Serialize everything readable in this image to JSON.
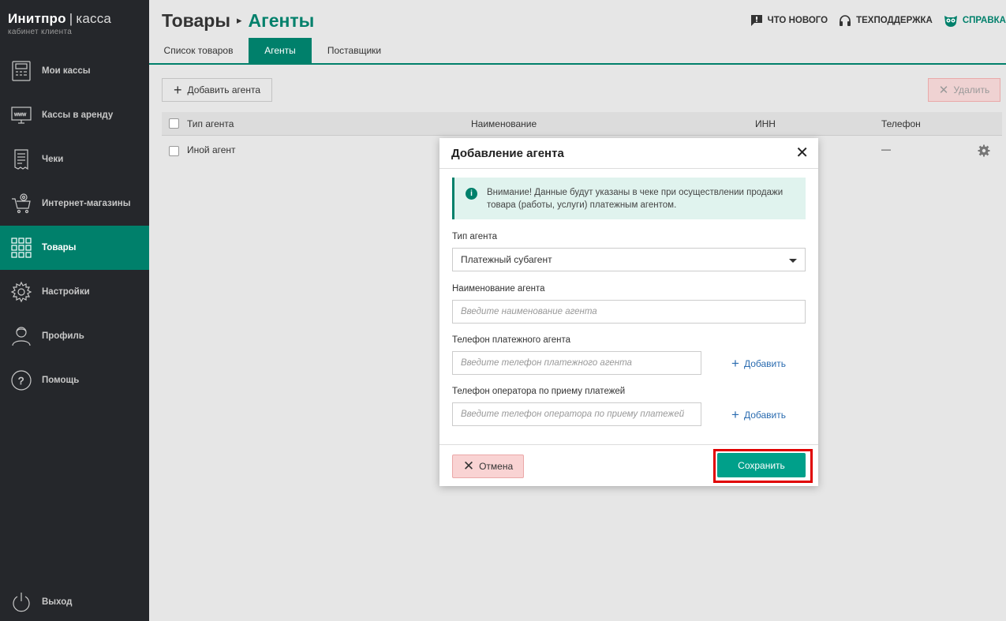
{
  "brand": {
    "name": "Инитпро",
    "separator": "|",
    "product": "касса",
    "subtitle": "кабинет клиента"
  },
  "sidebar": {
    "items": [
      {
        "label": "Мои кассы",
        "icon": "cash-register-icon"
      },
      {
        "label": "Кассы в аренду",
        "icon": "www-monitor-icon"
      },
      {
        "label": "Чеки",
        "icon": "receipt-icon"
      },
      {
        "label": "Интернет-магазины",
        "icon": "cart-at-icon"
      },
      {
        "label": "Товары",
        "icon": "grid-icon",
        "active": true
      },
      {
        "label": "Настройки",
        "icon": "gear-icon"
      },
      {
        "label": "Профиль",
        "icon": "user-icon"
      },
      {
        "label": "Помощь",
        "icon": "question-icon"
      }
    ],
    "logout": {
      "label": "Выход",
      "icon": "power-icon"
    }
  },
  "header": {
    "breadcrumb_parent": "Товары",
    "breadcrumb_current": "Агенты",
    "links": {
      "whats_new": "ЧТО НОВОГО",
      "support": "ТЕХПОДДЕРЖКА",
      "help": "СПРАВКА"
    }
  },
  "tabs": [
    {
      "label": "Список товаров"
    },
    {
      "label": "Агенты",
      "active": true
    },
    {
      "label": "Поставщики"
    }
  ],
  "toolbar": {
    "add_label": "Добавить агента",
    "delete_label": "Удалить"
  },
  "table": {
    "columns": [
      "Тип агента",
      "Наименование",
      "ИНН",
      "Телефон"
    ],
    "rows": [
      {
        "type": "Иной агент",
        "name": "",
        "inn": "",
        "phone": "—"
      }
    ]
  },
  "modal": {
    "title": "Добавление агента",
    "notice": "Внимание! Данные будут указаны в чеке при осуществлении продажи товара (работы, услуги) платежным агентом.",
    "agent_type_label": "Тип агента",
    "agent_type_value": "Платежный субагент",
    "agent_name_label": "Наименование агента",
    "agent_name_placeholder": "Введите наименование агента",
    "agent_phone_label": "Телефон платежного агента",
    "agent_phone_placeholder": "Введите телефон платежного агента",
    "operator_phone_label": "Телефон оператора по приему платежей",
    "operator_phone_placeholder": "Введите телефон оператора по приему платежей",
    "add_label": "Добавить",
    "cancel_label": "Отмена",
    "save_label": "Сохранить"
  },
  "colors": {
    "accent": "#00806b",
    "save": "#00a08a",
    "highlight": "#e00000",
    "sidebar_bg": "#25272b"
  }
}
